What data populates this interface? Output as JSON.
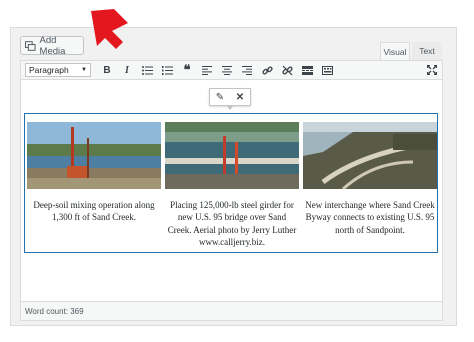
{
  "editor": {
    "add_media_label": "Add Media",
    "tabs": {
      "visual": "Visual",
      "text": "Text"
    },
    "format_select": "Paragraph",
    "toolbar_icons": [
      "bold-icon",
      "italic-icon",
      "bulleted-list-icon",
      "numbered-list-icon",
      "blockquote-icon",
      "align-left-icon",
      "align-center-icon",
      "align-right-icon",
      "insert-link-icon",
      "remove-link-icon",
      "read-more-icon",
      "toolbar-toggle-icon",
      "fullscreen-icon"
    ],
    "word_count": "Word count: 369"
  },
  "gallery": {
    "items": [
      {
        "caption": "Deep-soil mixing operation along 1,300 ft of Sand Creek."
      },
      {
        "caption": "Placing 125,000-lb steel girder for new U.S. 95 bridge over Sand Creek. Aerial photo by Jerry Luther www.calljerry.biz."
      },
      {
        "caption": "New interchange where Sand Creek Byway connects to existing U.S. 95 north of Sandpoint."
      }
    ]
  },
  "colors": {
    "selection_border": "#2271b1",
    "annotation_arrow": "#e3171d"
  }
}
